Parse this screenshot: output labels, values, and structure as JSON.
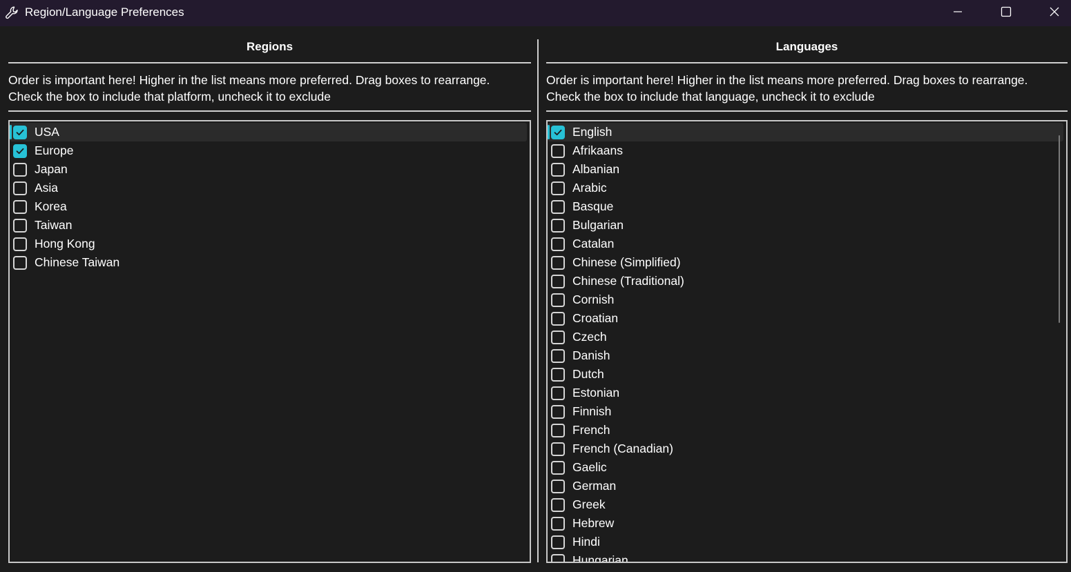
{
  "window": {
    "title": "Region/Language Preferences",
    "icon": "wrench-icon",
    "controls": [
      "minimize-icon",
      "maximize-icon",
      "close-icon"
    ]
  },
  "colors": {
    "titlebar": "#231a2e",
    "background": "#1c1c1c",
    "accent": "#27c1d6",
    "border": "#c8c8c8"
  },
  "regions": {
    "header": "Regions",
    "description_line1": "Order is important here! Higher in the list means more preferred. Drag boxes to rearrange.",
    "description_line2": "Check the box to include that platform, uncheck it to exclude",
    "items": [
      {
        "label": "USA",
        "checked": true,
        "selected": true
      },
      {
        "label": "Europe",
        "checked": true,
        "selected": false
      },
      {
        "label": "Japan",
        "checked": false,
        "selected": false
      },
      {
        "label": "Asia",
        "checked": false,
        "selected": false
      },
      {
        "label": "Korea",
        "checked": false,
        "selected": false
      },
      {
        "label": "Taiwan",
        "checked": false,
        "selected": false
      },
      {
        "label": "Hong Kong",
        "checked": false,
        "selected": false
      },
      {
        "label": "Chinese Taiwan",
        "checked": false,
        "selected": false
      }
    ]
  },
  "languages": {
    "header": "Languages",
    "description_line1": "Order is important here! Higher in the list means more preferred. Drag boxes to rearrange.",
    "description_line2": "Check the box to include that language, uncheck it to exclude",
    "items": [
      {
        "label": "English",
        "checked": true,
        "selected": true
      },
      {
        "label": "Afrikaans",
        "checked": false,
        "selected": false
      },
      {
        "label": "Albanian",
        "checked": false,
        "selected": false
      },
      {
        "label": "Arabic",
        "checked": false,
        "selected": false
      },
      {
        "label": "Basque",
        "checked": false,
        "selected": false
      },
      {
        "label": "Bulgarian",
        "checked": false,
        "selected": false
      },
      {
        "label": "Catalan",
        "checked": false,
        "selected": false
      },
      {
        "label": "Chinese (Simplified)",
        "checked": false,
        "selected": false
      },
      {
        "label": "Chinese (Traditional)",
        "checked": false,
        "selected": false
      },
      {
        "label": "Cornish",
        "checked": false,
        "selected": false
      },
      {
        "label": "Croatian",
        "checked": false,
        "selected": false
      },
      {
        "label": "Czech",
        "checked": false,
        "selected": false
      },
      {
        "label": "Danish",
        "checked": false,
        "selected": false
      },
      {
        "label": "Dutch",
        "checked": false,
        "selected": false
      },
      {
        "label": "Estonian",
        "checked": false,
        "selected": false
      },
      {
        "label": "Finnish",
        "checked": false,
        "selected": false
      },
      {
        "label": "French",
        "checked": false,
        "selected": false
      },
      {
        "label": "French (Canadian)",
        "checked": false,
        "selected": false
      },
      {
        "label": "Gaelic",
        "checked": false,
        "selected": false
      },
      {
        "label": "German",
        "checked": false,
        "selected": false
      },
      {
        "label": "Greek",
        "checked": false,
        "selected": false
      },
      {
        "label": "Hebrew",
        "checked": false,
        "selected": false
      },
      {
        "label": "Hindi",
        "checked": false,
        "selected": false
      },
      {
        "label": "Hungarian",
        "checked": false,
        "selected": false
      }
    ]
  }
}
